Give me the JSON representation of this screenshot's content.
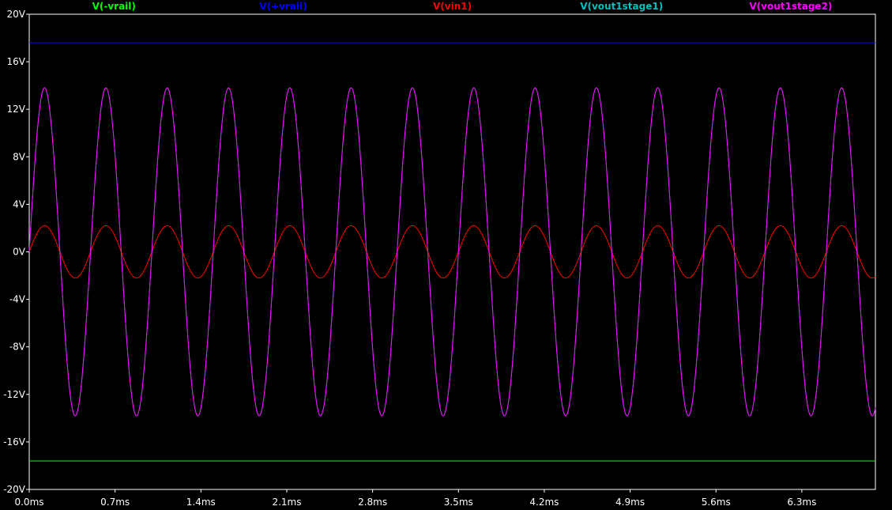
{
  "chart_data": {
    "type": "line",
    "title": "",
    "xlabel": "",
    "ylabel": "",
    "background": "#000000",
    "grid": false,
    "legend_position": "top",
    "xlim": [
      0,
      6.9
    ],
    "ylim": [
      -20,
      20
    ],
    "x_unit": "ms",
    "y_unit": "V",
    "x_ticks": [
      "0.0ms",
      "0.7ms",
      "1.4ms",
      "2.1ms",
      "2.8ms",
      "3.5ms",
      "4.2ms",
      "4.9ms",
      "5.6ms",
      "6.3ms"
    ],
    "x_tick_values": [
      0.0,
      0.7,
      1.4,
      2.1,
      2.8,
      3.5,
      4.2,
      4.9,
      5.6,
      6.3
    ],
    "y_ticks": [
      "20V",
      "16V",
      "12V",
      "8V",
      "4V",
      "0V",
      "-4V",
      "-8V",
      "-12V",
      "-16V",
      "-20V"
    ],
    "y_tick_values": [
      20,
      16,
      12,
      8,
      4,
      0,
      -4,
      -8,
      -12,
      -16,
      -20
    ],
    "series": [
      {
        "name": "V(-vrail)",
        "color": "#00ff00",
        "shape": "constant",
        "value": -17.6
      },
      {
        "name": "V(+vrail)",
        "color": "#0000ff",
        "shape": "constant",
        "value": 17.6
      },
      {
        "name": "V(vin1)",
        "color": "#ff0000",
        "shape": "sine",
        "amplitude": 2.2,
        "frequency_khz": 2,
        "phase_deg": 0
      },
      {
        "name": "V(vout1stage1)",
        "color": "#00c0c0",
        "shape": "sine",
        "amplitude": 13.8,
        "frequency_khz": 2,
        "phase_deg": 0
      },
      {
        "name": "V(vout1stage2)",
        "color": "#ff00ff",
        "shape": "sine",
        "amplitude": 13.8,
        "frequency_khz": 2,
        "phase_deg": 0
      }
    ]
  }
}
